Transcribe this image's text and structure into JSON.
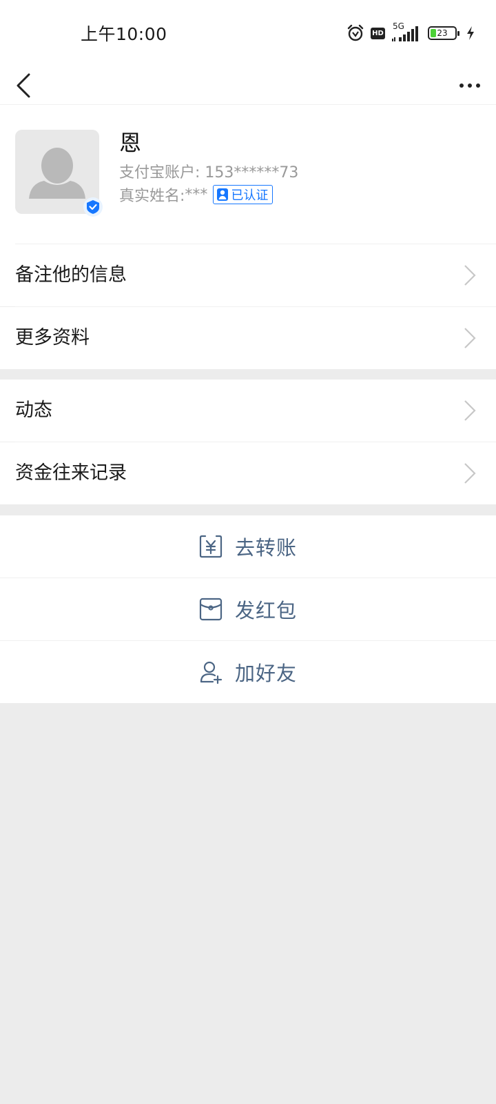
{
  "status_bar": {
    "time": "上午10:00",
    "hd_label": "HD",
    "network_label": "5G",
    "battery_level": "23",
    "battery_percent": 23,
    "icons": [
      "alarm-icon",
      "hd-icon",
      "signal-5g-icon",
      "battery-icon",
      "charging-icon"
    ]
  },
  "nav": {
    "back_icon": "chevron-left-icon",
    "more_icon": "more-horizontal-icon"
  },
  "profile": {
    "nickname": "恩",
    "account_label": "支付宝账户: ",
    "account_value": "153******73",
    "realname_label": "真实姓名: ",
    "realname_value": "***",
    "verified_label": "已认证",
    "avatar_icon": "default-avatar-icon",
    "badge_icon": "verified-badge-icon"
  },
  "group1": {
    "items": [
      {
        "label": "备注他的信息"
      },
      {
        "label": "更多资料"
      }
    ]
  },
  "group2": {
    "items": [
      {
        "label": "动态"
      },
      {
        "label": "资金往来记录"
      }
    ]
  },
  "actions": {
    "items": [
      {
        "label": "去转账",
        "icon": "transfer-yuan-icon"
      },
      {
        "label": "发红包",
        "icon": "red-envelope-icon"
      },
      {
        "label": "加好友",
        "icon": "add-friend-icon"
      }
    ]
  },
  "colors": {
    "accent_blue": "#1677ff",
    "action_text": "#4b6584",
    "background_gray": "#ececec"
  }
}
